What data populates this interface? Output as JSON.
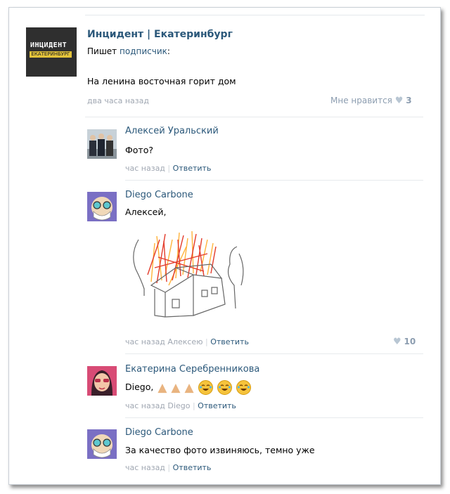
{
  "post": {
    "group_name": "Инцидент | Екатеринбург",
    "avatar_line1": "ИНЦИДЕНТ",
    "avatar_line2": "ЕКАТЕРИНБУРГ",
    "writes_prefix": "Пишет",
    "writes_link": "подписчик",
    "writes_suffix": ":",
    "text": "На ленина восточная горит дом",
    "time": "два часа назад",
    "like_label": "Мне нравится",
    "like_count": "3"
  },
  "comments": [
    {
      "author": "Алексей Уральский",
      "text": "Фото?",
      "time": "час назад",
      "reply": "Ответить"
    },
    {
      "author": "Diego Carbone",
      "text": "Алексей,",
      "time": "час назад",
      "to": "Алексею",
      "reply": "Ответить",
      "like_count": "10"
    },
    {
      "author": "Екатерина Серебренникова",
      "text": "Diego,",
      "time": "час назад",
      "to": "Diego",
      "reply": "Ответить"
    },
    {
      "author": "Diego Carbone",
      "text": "За качество фото извиняюсь, темно уже",
      "time": "час назад",
      "reply": "Ответить"
    }
  ],
  "colors": {
    "link": "#2b587a",
    "muted": "#a0a7b2",
    "like_heart": "#b8c6d3"
  },
  "icons": [
    "heart-icon",
    "thumbs-up-emoji",
    "crying-laughing-emoji",
    "drawing-image"
  ]
}
